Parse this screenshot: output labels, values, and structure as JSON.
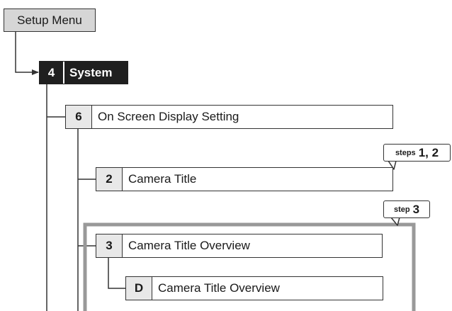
{
  "root": {
    "label": "Setup Menu"
  },
  "nodes": {
    "system": {
      "number": "4",
      "label": "System"
    },
    "osd": {
      "number": "6",
      "label": "On Screen Display Setting"
    },
    "camera_title": {
      "number": "2",
      "label": "Camera Title"
    },
    "camera_title_overview": {
      "number": "3",
      "label": "Camera Title Overview"
    },
    "camera_title_overview_d": {
      "number": "D",
      "label": "Camera Title Overview"
    }
  },
  "callouts": {
    "steps_1_2": {
      "word": "steps",
      "numbers": "1, 2"
    },
    "step_3": {
      "word": "step",
      "numbers": "3"
    }
  },
  "colors": {
    "root_fill": "#d6d6d6",
    "system_fill": "#1f1f1f",
    "number_cell_fill": "#e8e8e8",
    "highlight_frame": "#999999",
    "line": "#333333"
  }
}
